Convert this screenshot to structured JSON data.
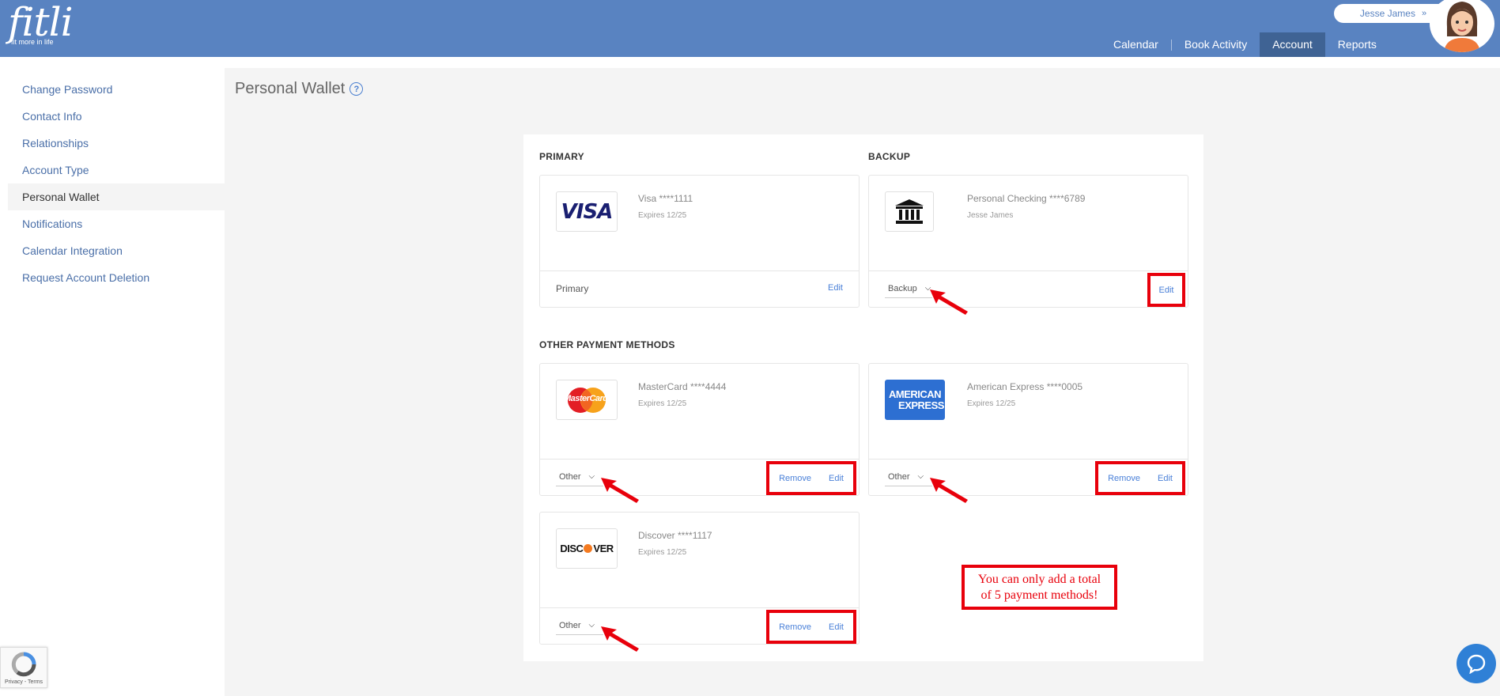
{
  "app": {
    "logo_word": "fitli",
    "logo_tagline": "fit more in life"
  },
  "header": {
    "user_name": "Jesse James",
    "nav": [
      "Calendar",
      "Book Activity",
      "Account",
      "Reports"
    ],
    "active_nav": "Account"
  },
  "sidebar": {
    "items": [
      {
        "label": "Change Password"
      },
      {
        "label": "Contact Info"
      },
      {
        "label": "Relationships"
      },
      {
        "label": "Account Type"
      },
      {
        "label": "Personal Wallet"
      },
      {
        "label": "Notifications"
      },
      {
        "label": "Calendar Integration"
      },
      {
        "label": "Request Account Deletion"
      }
    ],
    "active": "Personal Wallet"
  },
  "page": {
    "title": "Personal Wallet",
    "help_icon": "question-circle-icon"
  },
  "sections": {
    "primary": "PRIMARY",
    "backup": "BACKUP",
    "other": "OTHER PAYMENT METHODS"
  },
  "cards": {
    "visa": {
      "logo": "VISA",
      "name": "Visa ****1111",
      "sub": "Expires 12/25",
      "status": "Primary",
      "edit": "Edit"
    },
    "checking": {
      "logo": "bank-icon",
      "name": "Personal Checking ****6789",
      "sub": "Jesse James",
      "status": "Backup",
      "edit": "Edit"
    },
    "mastercard": {
      "logo": "MasterCard",
      "name": "MasterCard ****4444",
      "sub": "Expires 12/25",
      "status": "Other",
      "remove": "Remove",
      "edit": "Edit"
    },
    "amex": {
      "logo_line1": "AMERICAN",
      "logo_line2": "EXPRESS",
      "name": "American Express ****0005",
      "sub": "Expires 12/25",
      "status": "Other",
      "remove": "Remove",
      "edit": "Edit"
    },
    "discover": {
      "logo_a": "DISC",
      "logo_b": "VER",
      "name": "Discover ****1117",
      "sub": "Expires 12/25",
      "status": "Other",
      "remove": "Remove",
      "edit": "Edit"
    }
  },
  "note": {
    "line1": "You can only add a total",
    "line2": "of 5 payment methods!"
  },
  "recaptcha": {
    "text": "Privacy - Terms"
  },
  "colors": {
    "header": "#5983c1",
    "nav_active": "#3f6394",
    "link": "#4a80d8",
    "annotation": "#e8000b",
    "amex": "#2d6fd2",
    "visa": "#1a1f71"
  }
}
